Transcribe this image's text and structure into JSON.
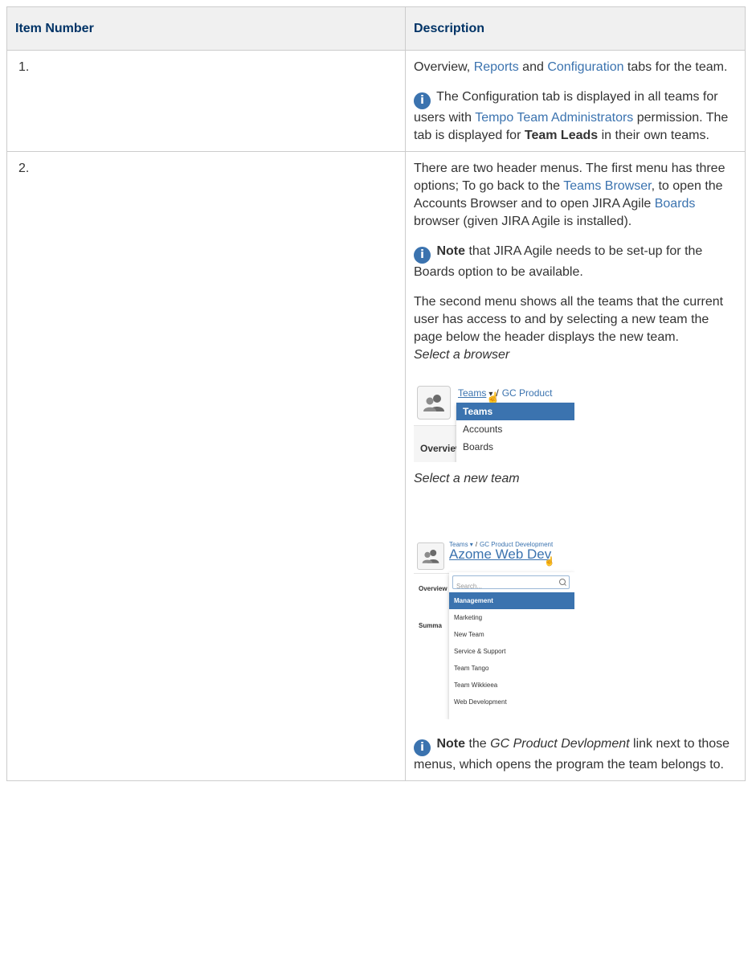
{
  "table": {
    "headers": [
      "Item Number",
      "Description"
    ],
    "rows": [
      {
        "number": "1.",
        "desc": {
          "p1": {
            "a": "Overview, ",
            "link1": "Reports",
            "b": " and ",
            "link2": "Configuration",
            "c": " tabs for the team."
          },
          "note": {
            "a": " The Configuration tab is displayed in all teams for users with ",
            "link": "Tempo Team Administrators",
            "b": " permission. The tab is displayed for ",
            "bold": "Team Leads",
            "c": " in their own teams."
          }
        }
      },
      {
        "number": "2.",
        "desc": {
          "p1": {
            "a": "There are two header menus. The first menu has three options; To go back to the ",
            "link1": "Teams Browser",
            "b": ", to open the Accounts Browser and to open JIRA Agile ",
            "link2": "Boards",
            "c": " browser (given JIRA Agile is installed)."
          },
          "note1": {
            "bold": "Note",
            "a": " that JIRA Agile needs to be set-up for the Boards option to be available."
          },
          "p2": "The second menu shows all the teams that the current user has access to and by selecting a new team the page below the header displays the new team.",
          "caption1": "Select a browser",
          "shot1": {
            "crumb_teams": "Teams",
            "crumb_sep": "/",
            "crumb_program": "GC Product",
            "menu_items": [
              "Teams",
              "Accounts",
              "Boards"
            ],
            "tab": "Overview"
          },
          "caption2": "Select a new team",
          "shot2": {
            "crumb_teams": "Teams",
            "crumb_caret": "▾",
            "crumb_sep": "/",
            "crumb_program": "GC Product Development",
            "team_name": "Azome Web Dev",
            "search_placeholder": "Search...",
            "tab": "Overview",
            "summary": "Summa",
            "menu_items": [
              "Management",
              "Marketing",
              "New Team",
              "Service & Support",
              "Team Tango",
              "Team Wikkieea",
              "Web Development"
            ]
          },
          "note2": {
            "bold": "Note",
            "a": " the ",
            "italic": "GC Product Devlopment",
            "b": " link next to those menus, which opens the program the team belongs to."
          }
        }
      }
    ]
  },
  "colors": {
    "header_text": "#003366",
    "link": "#3b73af",
    "header_bg": "#f0f0f0",
    "border": "#cccccc"
  },
  "icons": {
    "info": "info-icon",
    "team": "people-icon",
    "cursor": "hand-pointer-icon"
  }
}
